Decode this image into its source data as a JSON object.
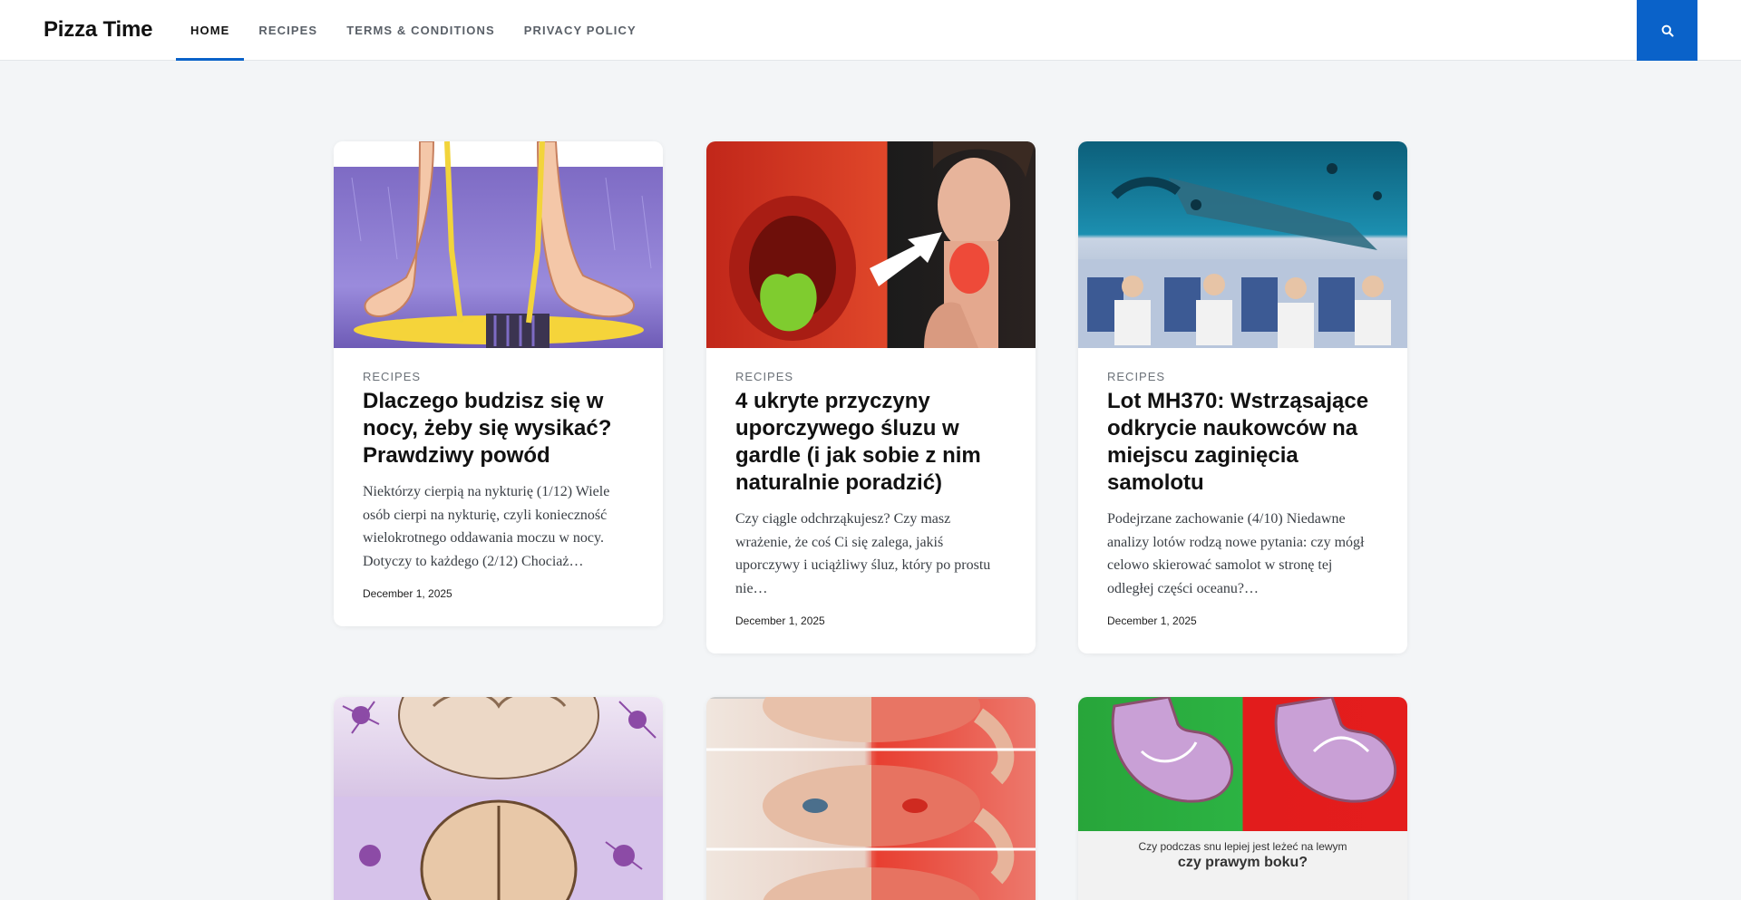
{
  "site": {
    "title": "Pizza Time"
  },
  "nav": {
    "items": [
      {
        "label": "HOME",
        "active": true
      },
      {
        "label": "RECIPES"
      },
      {
        "label": "TERMS & CONDITIONS"
      },
      {
        "label": "PRIVACY POLICY"
      }
    ],
    "search_icon": "search-icon"
  },
  "colors": {
    "accent": "#0a62c9",
    "background": "#f3f5f7"
  },
  "posts": [
    {
      "category": "RECIPES",
      "title": "Dlaczego budzisz się w nocy, żeby się wysikać? Prawdziwy powód",
      "excerpt": "Niektórzy cierpią na nykturię  (1/12) Wiele osób cierpi na nykturię, czyli konieczność wielokrotnego oddawania moczu w nocy. Dotyczy to każdego  (2/12) Chociaż…",
      "date": "December 1, 2025"
    },
    {
      "category": "RECIPES",
      "title": "4 ukryte przyczyny uporczywego śluzu w gardle (i jak sobie z nim naturalnie poradzić)",
      "excerpt": "Czy ciągle odchrząkujesz? Czy masz wrażenie, że coś Ci się zalega, jakiś uporczywy i uciążliwy śluz, który po prostu nie…",
      "date": "December 1, 2025"
    },
    {
      "category": "RECIPES",
      "title": "Lot MH370: Wstrząsające odkrycie naukowców na miejscu zaginięcia samolotu",
      "excerpt": "Podejrzane zachowanie (4/10) Niedawne analizy lotów rodzą nowe pytania: czy mógł celowo skierować samolot w stronę tej odległej części oceanu?…",
      "date": "December 1, 2025"
    },
    {
      "image_caption": {
        "line1": "",
        "line2": ""
      }
    },
    {
      "image_caption": {
        "line1": "",
        "line2": ""
      }
    },
    {
      "image_caption": {
        "line1": "Czy podczas snu lepiej jest leżeć na lewym",
        "line2": "czy prawym boku?"
      }
    }
  ]
}
